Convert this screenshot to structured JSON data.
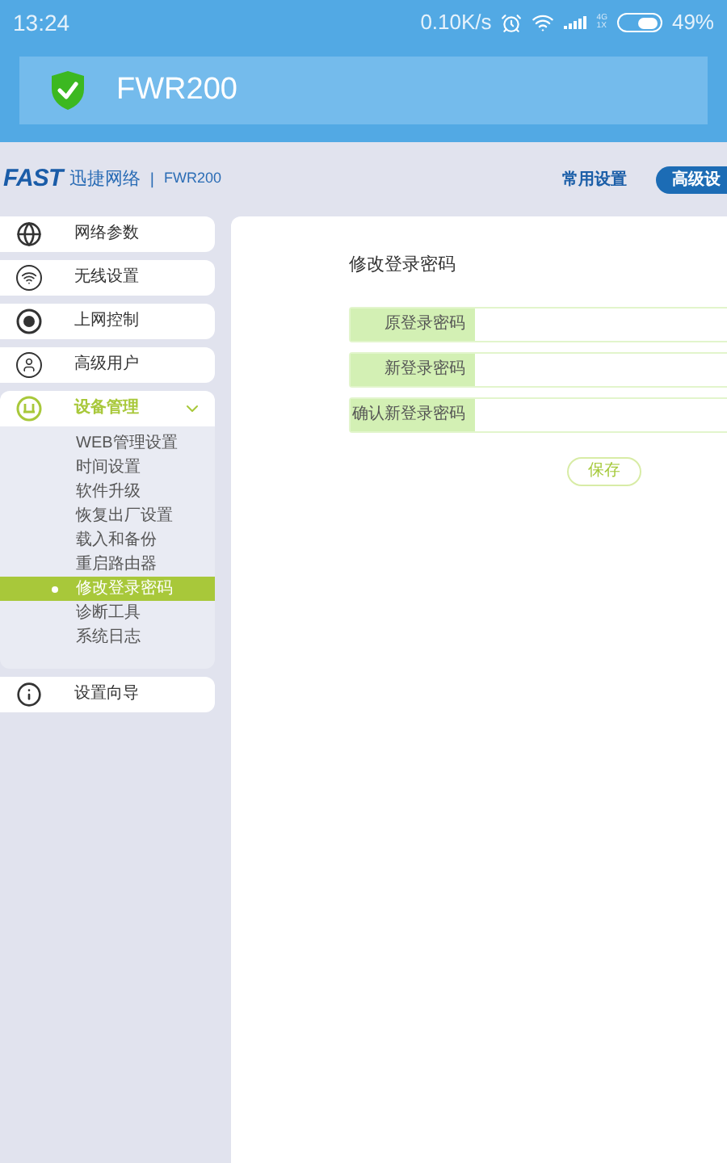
{
  "status_bar": {
    "time": "13:24",
    "speed": "0.10K/s",
    "network_top": "4G",
    "network_bottom": "1X",
    "battery": "49%"
  },
  "title_bar": {
    "title": "FWR200"
  },
  "header": {
    "logo": "FAST",
    "brand": "迅捷网络",
    "separator": "|",
    "model": "FWR200",
    "tabs": [
      {
        "label": "常用设置",
        "selected": false
      },
      {
        "label": "高级设",
        "selected": true
      }
    ]
  },
  "menu": [
    {
      "label": "网络参数",
      "expanded": false
    },
    {
      "label": "无线设置",
      "expanded": false
    },
    {
      "label": "上网控制",
      "expanded": false
    },
    {
      "label": "高级用户",
      "expanded": false
    },
    {
      "label": "设备管理",
      "expanded": true,
      "children": [
        {
          "label": "WEB管理设置",
          "selected": false
        },
        {
          "label": "时间设置",
          "selected": false
        },
        {
          "label": "软件升级",
          "selected": false
        },
        {
          "label": "恢复出厂设置",
          "selected": false
        },
        {
          "label": "载入和备份",
          "selected": false
        },
        {
          "label": "重启路由器",
          "selected": false
        },
        {
          "label": "修改登录密码",
          "selected": true
        },
        {
          "label": "诊断工具",
          "selected": false
        },
        {
          "label": "系统日志",
          "selected": false
        }
      ]
    },
    {
      "label": "设置向导",
      "expanded": false
    }
  ],
  "form": {
    "title": "修改登录密码",
    "fields": [
      {
        "label": "原登录密码"
      },
      {
        "label": "新登录密码"
      },
      {
        "label": "确认新登录密码"
      }
    ],
    "save_button": "保存"
  }
}
